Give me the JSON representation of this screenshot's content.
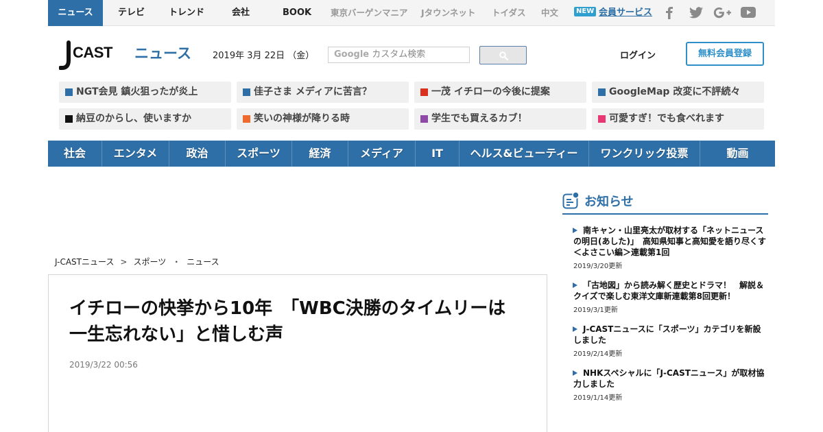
{
  "topbar": {
    "tabs": [
      {
        "label": "ニュース"
      },
      {
        "label": "テレビ"
      },
      {
        "label": "トレンド"
      },
      {
        "label": "会社"
      },
      {
        "label": "BOOK"
      },
      {
        "label": "東京バーゲンマニア"
      },
      {
        "label": "Jタウンネット"
      },
      {
        "label": "トイダス"
      },
      {
        "label": "中文"
      }
    ],
    "new_badge": "NEW",
    "member_service": "会員サービス",
    "social_icons": [
      "facebook-icon",
      "twitter-icon",
      "google-plus-icon",
      "youtube-icon"
    ]
  },
  "header": {
    "logo_text": "J-CAST",
    "logo_sub": "ニュース",
    "date": "2019年 3月 22日 （金）",
    "search": {
      "brand": "Google",
      "placeholder": "カスタム検索"
    },
    "login": "ログイン",
    "register": "無料会員登録"
  },
  "topics": [
    {
      "label": "NGT会見 鎮火狙ったが炎上",
      "color": "#2d6fa6"
    },
    {
      "label": "佳子さま メディアに苦言？",
      "color": "#2d6fa6"
    },
    {
      "label": "一茂 イチローの今後に提案",
      "color": "#d9301f"
    },
    {
      "label": "GoogleMap 改変に不評続々",
      "color": "#2d6fa6"
    },
    {
      "label": "納豆のからし、使いますか",
      "color": "#111111"
    },
    {
      "label": "笑いの神様が降りる時",
      "color": "#ef6a2f"
    },
    {
      "label": "学生でも買えるカブ！",
      "color": "#8e4aa6"
    },
    {
      "label": "可愛すぎ！でも食べれます",
      "color": "#e93773"
    }
  ],
  "categories": [
    "社会",
    "エンタメ",
    "政治",
    "スポーツ",
    "経済",
    "メディア",
    "IT",
    "ヘルス&ビューティー",
    "ワンクリック投票",
    "動画"
  ],
  "breadcrumb": {
    "home": "J-CASTニュース",
    "sep1": ">",
    "section": "スポーツ",
    "sep2": "・",
    "page": "ニュース"
  },
  "article": {
    "title": "イチローの快挙から10年　「WBC決勝のタイムリーは一生忘れない」と惜しむ声",
    "time": "2019/3/22 00:56"
  },
  "sidebar": {
    "title": "お知らせ",
    "items": [
      {
        "headline": "南キャン・山里亮太が取材する「ネットニュースの明日(あした)」　高知県知事と高知愛を語り尽くす＜よさこい編＞連載第1回",
        "updated": "2019/3/20更新"
      },
      {
        "headline": "「古地図」から読み解く歴史とドラマ！　解説＆クイズで楽しむ東洋文庫新連載第8回更新！",
        "updated": "2019/3/1更新"
      },
      {
        "headline": "J-CASTニュースに「スポーツ」カテゴリを新設しました",
        "updated": "2019/2/14更新"
      },
      {
        "headline": "NHKスペシャルに「J-CASTニュース」が取材協力しました",
        "updated": "2019/1/14更新"
      }
    ]
  },
  "colors": {
    "brand_blue": "#2d6fa6",
    "accent_cyan": "#2e8fc9"
  }
}
